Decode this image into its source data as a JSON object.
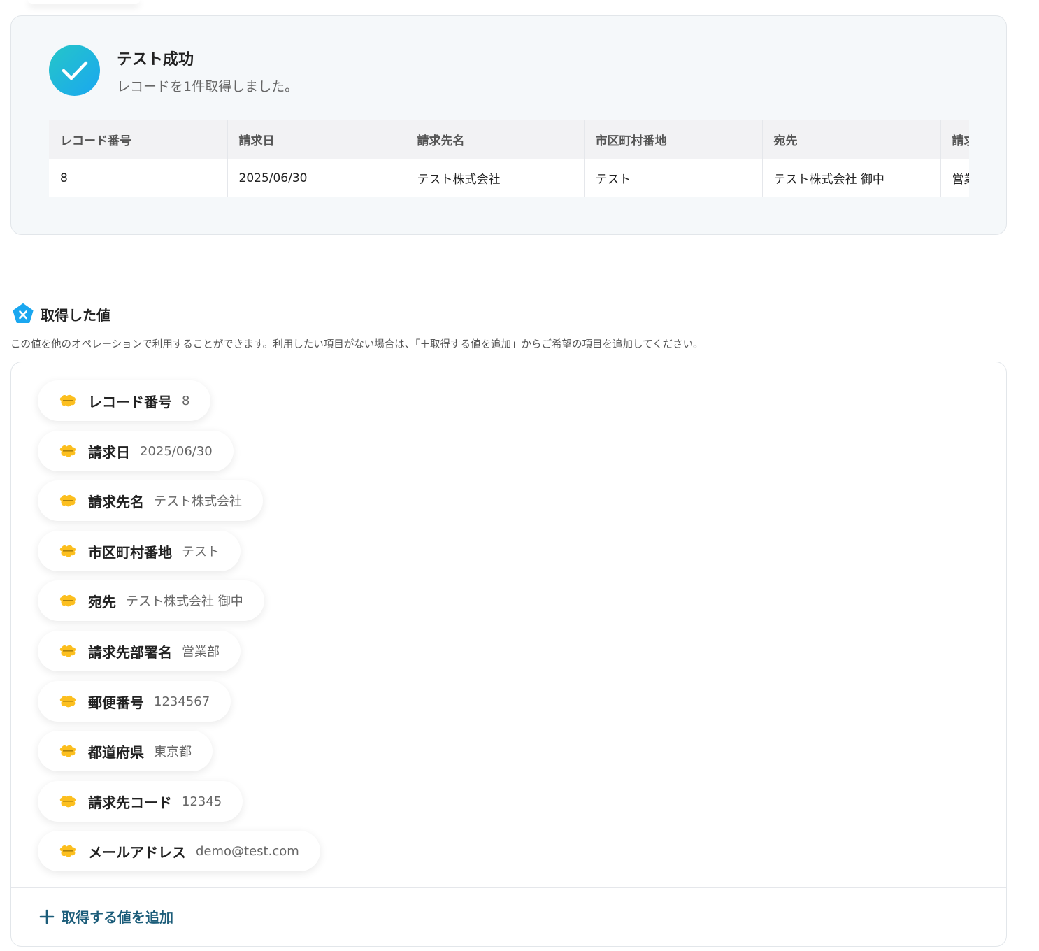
{
  "colors": {
    "accent_teal": "#25c6c8",
    "accent_blue": "#1aa7f0",
    "kintone_yellow": "#fcbf1f",
    "add_link": "#1c5d7a"
  },
  "success": {
    "title": "テスト成功",
    "message": "レコードを1件取得しました。",
    "icon": "check-icon"
  },
  "table": {
    "headers": [
      "レコード番号",
      "請求日",
      "請求先名",
      "市区町村番地",
      "宛先",
      "請求先部署名"
    ],
    "row": [
      "8",
      "2025/06/30",
      "テスト株式会社",
      "テスト",
      "テスト株式会社 御中",
      "営業部"
    ]
  },
  "section": {
    "title": "取得した値",
    "icon": "yoom-x-icon",
    "description": "この値を他のオペレーションで利用することができます。利用したい項目がない場合は、「＋取得する値を追加」からご希望の項目を追加してください。"
  },
  "values": [
    {
      "label": "レコード番号",
      "value": "8"
    },
    {
      "label": "請求日",
      "value": "2025/06/30"
    },
    {
      "label": "請求先名",
      "value": "テスト株式会社"
    },
    {
      "label": "市区町村番地",
      "value": "テスト"
    },
    {
      "label": "宛先",
      "value": "テスト株式会社 御中"
    },
    {
      "label": "請求先部署名",
      "value": "営業部"
    },
    {
      "label": "郵便番号",
      "value": "1234567"
    },
    {
      "label": "都道府県",
      "value": "東京都"
    },
    {
      "label": "請求先コード",
      "value": "12345"
    },
    {
      "label": "メールアドレス",
      "value": "demo@test.com"
    }
  ],
  "value_icon": "kintone-icon",
  "add_button": {
    "label": "取得する値を追加",
    "icon": "plus-icon"
  }
}
